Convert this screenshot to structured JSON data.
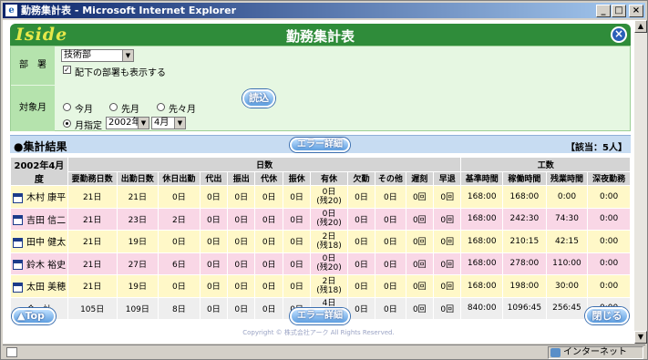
{
  "window": {
    "title": "勤務集計表 - Microsoft Internet Explorer",
    "ie_glyph": "e",
    "min_btn": "_",
    "max_btn": "□",
    "close_btn": "×"
  },
  "app": {
    "logo": "Iside",
    "title": "勤務集計表",
    "close_icon": "×"
  },
  "filters": {
    "dept_label": "部　署",
    "dept_value": "技術部",
    "show_sub_label": "配下の部署も表示する",
    "show_sub_checked": "✓",
    "period_label": "対象月",
    "radio_this": "今月",
    "radio_prev": "先月",
    "radio_prev2": "先々月",
    "radio_specify": "月指定",
    "year_value": "2002年",
    "month_value": "4月",
    "load_button": "読込"
  },
  "results": {
    "title": "●集計結果",
    "error_button": "エラー詳細",
    "count": "【該当：5人】"
  },
  "table": {
    "header_year": "2002年4月度",
    "group_days": "日数",
    "group_hours": "工数",
    "cols": [
      "要勤務日数",
      "出勤日数",
      "休日出勤",
      "代出",
      "振出",
      "代休",
      "振休",
      "有休",
      "欠勤",
      "その他",
      "遅刻",
      "早退",
      "基準時間",
      "稼働時間",
      "残業時間",
      "深夜勤務"
    ],
    "rows": [
      {
        "name": "木村 康平",
        "v": [
          "21日",
          "21日",
          "0日",
          "0日",
          "0日",
          "0日",
          "0日",
          "0日",
          "0日",
          "0日",
          "0回",
          "0回",
          "168:00",
          "168:00",
          "0:00",
          "0:00"
        ],
        "yk": "(残20)"
      },
      {
        "name": "吉田 信二",
        "v": [
          "21日",
          "23日",
          "2日",
          "0日",
          "0日",
          "0日",
          "0日",
          "0日",
          "0日",
          "0日",
          "0回",
          "0回",
          "168:00",
          "242:30",
          "74:30",
          "0:00"
        ],
        "yk": "(残20)"
      },
      {
        "name": "田中 健太",
        "v": [
          "21日",
          "19日",
          "0日",
          "0日",
          "0日",
          "0日",
          "0日",
          "2日",
          "0日",
          "0日",
          "0回",
          "0回",
          "168:00",
          "210:15",
          "42:15",
          "0:00"
        ],
        "yk": "(残18)"
      },
      {
        "name": "鈴木 裕史",
        "v": [
          "21日",
          "27日",
          "6日",
          "0日",
          "0日",
          "0日",
          "0日",
          "0日",
          "0日",
          "0日",
          "0回",
          "0回",
          "168:00",
          "278:00",
          "110:00",
          "0:00"
        ],
        "yk": "(残20)"
      },
      {
        "name": "太田 美穂",
        "v": [
          "21日",
          "19日",
          "0日",
          "0日",
          "0日",
          "0日",
          "0日",
          "2日",
          "0日",
          "0日",
          "0回",
          "0回",
          "168:00",
          "198:00",
          "30:00",
          "0:00"
        ],
        "yk": "(残18)"
      }
    ],
    "total": {
      "name": "合　計",
      "v": [
        "105日",
        "109日",
        "8日",
        "0日",
        "0日",
        "0日",
        "0日",
        "4日",
        "0日",
        "0日",
        "0回",
        "0回",
        "840:00",
        "1096:45",
        "256:45",
        "0:00"
      ],
      "yk": "(残96)"
    }
  },
  "footer": {
    "top_button": "▲Top",
    "error_button": "エラー詳細",
    "close_button": "閉じる",
    "copyright": "Copyright © 株式会社アーク All Rights Reserved."
  },
  "statusbar": {
    "zone": "インターネット"
  }
}
